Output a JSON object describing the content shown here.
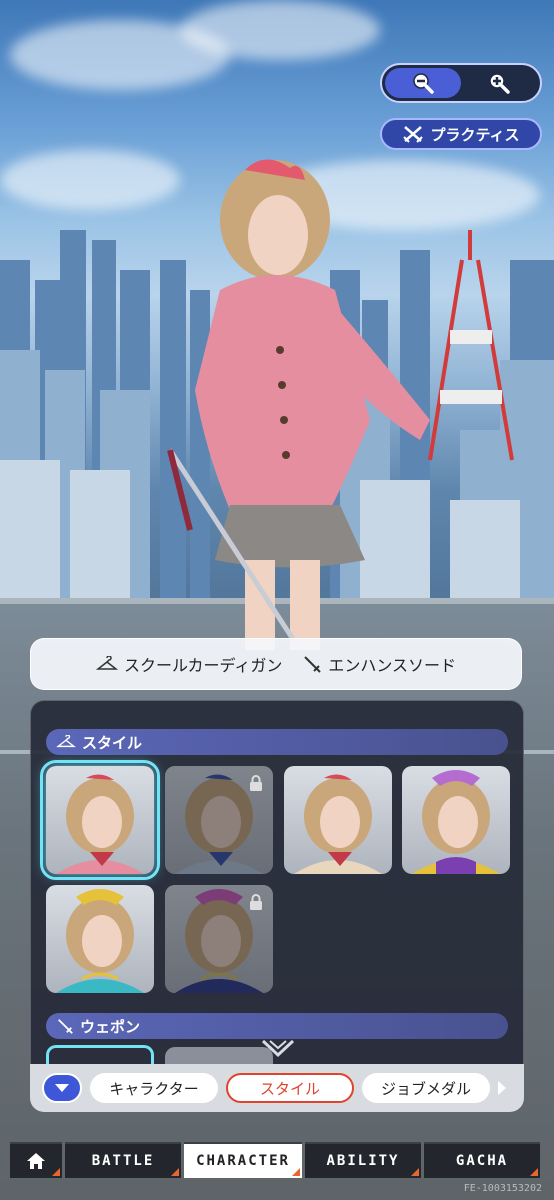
{
  "zoom": {
    "out_icon": "zoom-out-icon",
    "in_icon": "zoom-in-icon",
    "active": "out"
  },
  "practice": {
    "label": "プラクティス",
    "icon": "crossed-swords-icon"
  },
  "equipped": {
    "outfit": {
      "icon": "hanger-icon",
      "label": "スクールカーディガン"
    },
    "weapon": {
      "icon": "sword-icon",
      "label": "エンハンスソード"
    }
  },
  "panel": {
    "style_header": "スタイル",
    "weapon_header": "ウェポン",
    "styles": [
      {
        "name": "style-school",
        "selected": true,
        "locked": false
      },
      {
        "name": "style-blue-uniform",
        "selected": false,
        "locked": true
      },
      {
        "name": "style-beige-uniform",
        "selected": false,
        "locked": false
      },
      {
        "name": "style-purple-gold",
        "selected": false,
        "locked": false
      },
      {
        "name": "style-teal-crown",
        "selected": false,
        "locked": false
      },
      {
        "name": "style-navy-pink",
        "selected": false,
        "locked": true
      }
    ]
  },
  "tabs": [
    {
      "label": "キャラクター",
      "active": false
    },
    {
      "label": "スタイル",
      "active": true
    },
    {
      "label": "ジョブメダル",
      "active": false
    }
  ],
  "nav": [
    {
      "label": "",
      "icon": "home-icon",
      "active": false
    },
    {
      "label": "BATTLE",
      "active": false
    },
    {
      "label": "CHARACTER",
      "active": true
    },
    {
      "label": "ABILITY",
      "active": false
    },
    {
      "label": "GACHA",
      "active": false
    }
  ],
  "footer_id": "FE-1003153202"
}
